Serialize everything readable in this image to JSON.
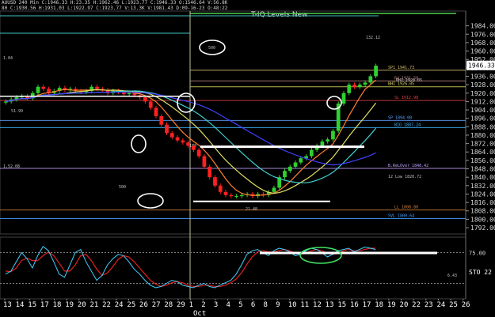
{
  "header": {
    "line1": "AUUSD 240 Min C:1946.33 H:23.35 H:1962.46 L:1923.77 C:1946.33 O:1546.64 V:56.8K",
    "line2": "80 C:1930.56 H:1931.03 L:1922.97 C:1923.77 V:13.3K V:1981.43 D:09-16-23 O:48:22",
    "title": "T-IQ Levels New"
  },
  "chart_data": {
    "type": "candlestick",
    "ylim": [
      1786,
      1998
    ],
    "x_tick_labels": [
      "13",
      "14",
      "15",
      "17",
      "18",
      "19",
      "20",
      "21",
      "22",
      "24",
      "25",
      "26",
      "27",
      "28",
      "29",
      "1",
      "2",
      "3",
      "4",
      "5",
      "6",
      "8",
      "9",
      "10",
      "11",
      "12",
      "13",
      "15",
      "16",
      "17",
      "18",
      "19",
      "20",
      "22",
      "23",
      "24",
      "25",
      "26"
    ],
    "x_month_label": "Oct",
    "y_ticks": [
      1984,
      1976,
      1968,
      1960,
      1952,
      1944,
      1936,
      1928,
      1920,
      1912,
      1904,
      1896,
      1888,
      1880,
      1872,
      1864,
      1856,
      1848,
      1840,
      1832,
      1824,
      1816,
      1808,
      1800,
      1792
    ],
    "last_price": "1946.33",
    "close": [
      1912,
      1914,
      1916,
      1917,
      1915,
      1920,
      1926,
      1924,
      1920,
      1922,
      1925,
      1923,
      1924,
      1922,
      1921,
      1922,
      1926,
      1924,
      1923,
      1920,
      1922,
      1921,
      1919,
      1920,
      1918,
      1916,
      1912,
      1906,
      1898,
      1890,
      1882,
      1878,
      1875,
      1873,
      1870,
      1866,
      1860,
      1850,
      1840,
      1832,
      1826,
      1823,
      1822,
      1822,
      1823,
      1824,
      1822,
      1824,
      1823,
      1826,
      1830,
      1840,
      1846,
      1850,
      1854,
      1858,
      1860,
      1866,
      1870,
      1874,
      1876,
      1884,
      1910,
      1920,
      1928,
      1926,
      1928,
      1930,
      1936,
      1946
    ],
    "levels": [
      {
        "label": "SP1 1941.73",
        "value": 1941.73,
        "color": "#d8c070"
      },
      {
        "label": "R4 1931.58",
        "value": 1931.58,
        "color": "#c08080"
      },
      {
        "label": "BHI 1926.05",
        "value": 1926.05,
        "color": "#d8d860"
      },
      {
        "label": "SL 1912.98",
        "value": 1912.98,
        "color": "#e04040"
      },
      {
        "label": "SP 1894.00",
        "value": 1894.0,
        "color": "#60a0ff"
      },
      {
        "label": "BIO 1887.24",
        "value": 1887.24,
        "color": "#40b8ff"
      },
      {
        "label": "B.ReLOver 1848.42",
        "value": 1848.42,
        "color": "#c0a0ff"
      },
      {
        "label": "LL 1808.80",
        "value": 1808.8,
        "color": "#d08040"
      },
      {
        "label": "SVL 1800.64",
        "value": 1800.64,
        "color": "#40a0ff"
      }
    ],
    "level_small_labels": [
      "132.12",
      "500",
      "150",
      "500",
      "51.99",
      "1.04",
      "1,52.08",
      "12 Low 1820.72",
      "21.48",
      "BHI 1926.05",
      "6.43"
    ],
    "indicator": {
      "name": "STO",
      "label": "STO 22",
      "level_label": "75.00",
      "value_label": "22",
      "k": [
        40,
        45,
        60,
        75,
        65,
        50,
        70,
        85,
        78,
        60,
        40,
        35,
        55,
        75,
        80,
        60,
        45,
        30,
        38,
        55,
        65,
        72,
        70,
        60,
        48,
        40,
        30,
        22,
        18,
        20,
        25,
        30,
        28,
        22,
        20,
        18,
        22,
        25,
        20,
        18,
        22,
        26,
        30,
        40,
        55,
        72,
        78,
        80,
        75,
        70,
        78,
        82,
        80,
        76,
        70,
        72,
        78,
        82,
        80,
        75,
        68,
        72,
        78,
        80,
        82,
        76,
        80,
        84,
        82,
        80
      ],
      "d": [
        45,
        44,
        50,
        62,
        66,
        62,
        62,
        70,
        76,
        70,
        58,
        45,
        45,
        55,
        70,
        72,
        62,
        48,
        38,
        42,
        52,
        64,
        70,
        68,
        60,
        50,
        40,
        30,
        24,
        20,
        22,
        26,
        28,
        26,
        22,
        20,
        20,
        22,
        22,
        20,
        20,
        22,
        26,
        32,
        42,
        56,
        68,
        76,
        78,
        76,
        76,
        78,
        80,
        78,
        74,
        72,
        74,
        78,
        80,
        78,
        74,
        72,
        74,
        78,
        80,
        78,
        78,
        80,
        82,
        82
      ]
    }
  }
}
